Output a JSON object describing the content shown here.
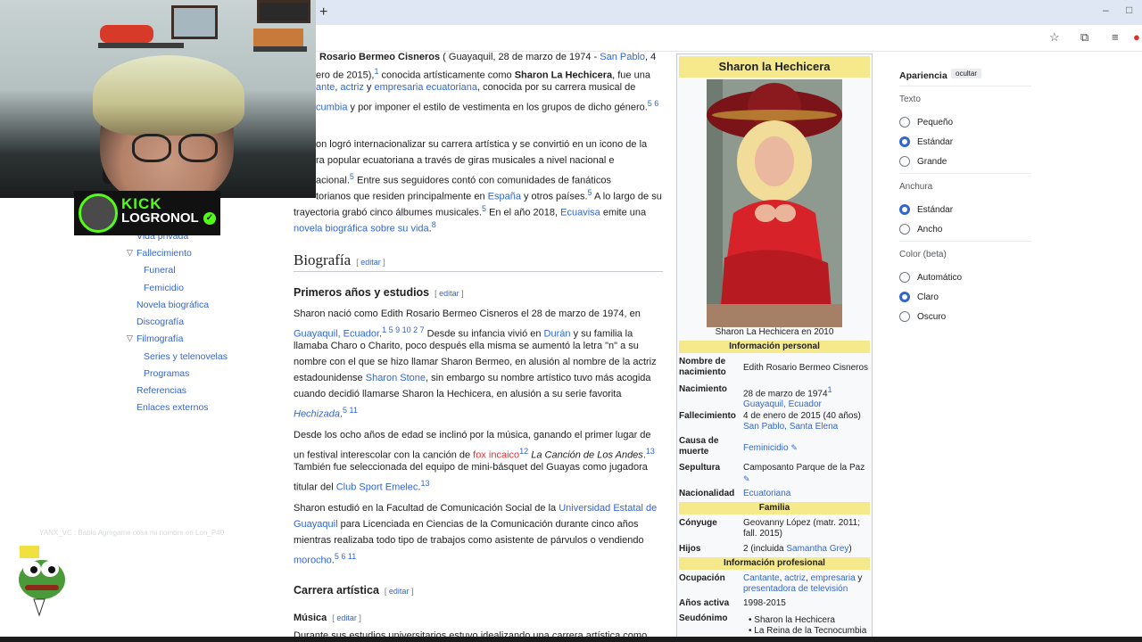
{
  "browser": {
    "new_tab": "+",
    "min": "–",
    "max": "□"
  },
  "toc": {
    "items": [
      {
        "label": "Vida privada"
      },
      {
        "label": "Fallecimiento"
      },
      {
        "label": "Funeral"
      },
      {
        "label": "Femicidio"
      },
      {
        "label": "Novela biográfica"
      },
      {
        "label": "Discografía"
      },
      {
        "label": "Filmografía"
      },
      {
        "label": "Series y telenovelas"
      },
      {
        "label": "Programas"
      },
      {
        "label": "Referencias"
      },
      {
        "label": "Enlaces externos"
      }
    ]
  },
  "article": {
    "intro": {
      "l1a": "Rosario Bermeo Cisneros",
      "l1b": " ( Guayaquil, 28 de marzo de 1974 - ",
      "l1c": "San Pablo",
      "l1d": ", 4",
      "l2a": "ero de 2015),",
      "l2b": " conocida artísticamente como ",
      "l2c": "Sharon La Hechicera",
      "l2d": ", fue una",
      "l3a": "ante",
      "l3b": ", ",
      "l3c": "actriz",
      "l3d": " y ",
      "l3e": "empresaria ecuatoriana",
      "l3f": ", conocida por su carrera musical de",
      "l4a": "cumbia",
      "l4b": " y por imponer el estilo de vestimenta en los grupos de dicho género.",
      "s1": "1",
      "s56": "5 6"
    },
    "para2": {
      "l1": "on logró internacionalizar su carrera artística y se convirtió en un icono de la",
      "l2": "ra popular ecuatoriana a través de giras musicales a nivel nacional e",
      "l3a": "acional.",
      "l3b": " Entre sus seguidores contó con comunidades de fanáticos",
      "l4a": "torianos que residen principalmente en ",
      "l4b": "España",
      "l4c": " y otros países.",
      "l4d": " A lo largo de su",
      "l5a": "trayectoria grabó cinco álbumes musicales.",
      "l5b": " En el año 2018, ",
      "l5c": "Ecuavisa",
      "l5d": " emite una",
      "l6a": "novela biográfica sobre su vida",
      "l6b": ".",
      "s5": "5",
      "s8": "8"
    },
    "biografia": "Biografía",
    "edit": "editar",
    "primeros": "Primeros años y estudios",
    "para3": {
      "l1": "Sharon nació como Edith Rosario Bermeo Cisneros el 28 de marzo de 1974, en",
      "l2a": "Guayaquil, Ecuador",
      "l2b": ".",
      "l2c": " Desde su infancia vivió en ",
      "l2d": "Durán",
      "l2e": " y su familia la",
      "s1": "1 5 9 10 2 7",
      "l3": "llamaba Charo o Charito, poco después ella misma se aumentó la letra \"n\" a su",
      "l4": "nombre con el que se hizo llamar Sharon Bermeo, en alusión al nombre de la actriz",
      "l5a": "estadounidense ",
      "l5b": "Sharon Stone",
      "l5c": ", sin embargo su nombre artístico tuvo más acogida",
      "l6": "cuando decidió llamarse Sharon la Hechicera, en alusión a su serie favorita",
      "l7a": "Hechizada",
      "l7b": ".",
      "s511": "5 11"
    },
    "para4": {
      "l1": "Desde los ocho años de edad se inclinó por la música, ganando el primer lugar de",
      "l2a": "un festival interescolar con la canción de ",
      "l2b": "fox incaico",
      "l2c": "  La Canción de Los Andes",
      "l2d": ".",
      "s12": "12",
      "s13a": "13",
      "l3": "También fue seleccionada del equipo de mini-básquet del Guayas como jugadora",
      "l4a": "titular del ",
      "l4b": "Club Sport Emelec",
      "l4c": ".",
      "s13b": "13"
    },
    "para5": {
      "l1a": "Sharon estudió en la Facultad de Comunicación Social de la ",
      "l1b": "Universidad Estatal de",
      "l2a": "Guayaquil",
      "l2b": " para Licenciada en Ciencias de la Comunicación durante cinco años",
      "l3": "mientras realizaba todo tipo de trabajos como asistente de párvulos o vendiendo",
      "l4a": "morocho",
      "l4b": ".",
      "s": "5 6 11"
    },
    "carrera": "Carrera artística",
    "musica": "Música",
    "para6": "Durante sus estudios universitarios estuvo idealizando una carrera artística como"
  },
  "infobox": {
    "title": "Sharon la Hechicera",
    "caption": "Sharon La Hechicera en 2010",
    "sec_personal": "Información personal",
    "sec_familia": "Familia",
    "sec_prof": "Información profesional",
    "rows": {
      "nombre_label": "Nombre de nacimiento",
      "nombre_val": "Edith Rosario Bermeo Cisneros",
      "nac_label": "Nacimiento",
      "nac_val": "28 de marzo de 1974",
      "nac_sup": "1",
      "nac_place": "Guayaquil, Ecuador",
      "fall_label": "Fallecimiento",
      "fall_val": "4 de enero de 2015 (40 años)",
      "fall_place": "San Pablo, Santa Elena",
      "causa_label": "Causa de muerte",
      "causa_val": "Feminicidio",
      "sep_label": "Sepultura",
      "sep_val": "Camposanto Parque de la Paz",
      "nac2_label": "Nacionalidad",
      "nac2_val": "Ecuatoriana",
      "cony_label": "Cónyuge",
      "cony_val1": "Geovanny López (matr. 2011;",
      "cony_val2": "fall. 2015)",
      "hijos_label": "Hijos",
      "hijos_val1": "2 (incluida ",
      "hijos_val2": "Samantha Grey",
      "hijos_val3": ")",
      "ocup_label": "Ocupación",
      "ocup_a": "Cantante",
      "ocup_b": ", ",
      "ocup_c": "actriz",
      "ocup_d": ", ",
      "ocup_e": "empresaria",
      "ocup_f": " y",
      "ocup_g": "presentadora de televisión",
      "anos_label": "Años activa",
      "anos_val": "1998-2015",
      "seud_label": "Seudónimo",
      "seud_1": "Sharon la Hechicera",
      "seud_2": "La Reina de la Tecnocumbia"
    }
  },
  "appearance": {
    "title": "Apariencia",
    "hide": "ocultar",
    "texto": "Texto",
    "texto_opts": [
      "Pequeño",
      "Estándar",
      "Grande"
    ],
    "texto_selected": "Estándar",
    "anchura": "Anchura",
    "anchura_opts": [
      "Estándar",
      "Ancho"
    ],
    "anchura_selected": "Estándar",
    "color": "Color (beta)",
    "color_opts": [
      "Automático",
      "Claro",
      "Oscuro"
    ],
    "color_selected": "Claro"
  },
  "overlay": {
    "kick": "KICK",
    "channel": "LOGRONOL",
    "chat_ghost": "YANX_VC : Bablo Agregame cosa mi nombre en Lon_P40"
  },
  "colors": {
    "accent": "#3366cc",
    "infobox_header": "#f5e98c",
    "kick_green": "#53fc18"
  }
}
